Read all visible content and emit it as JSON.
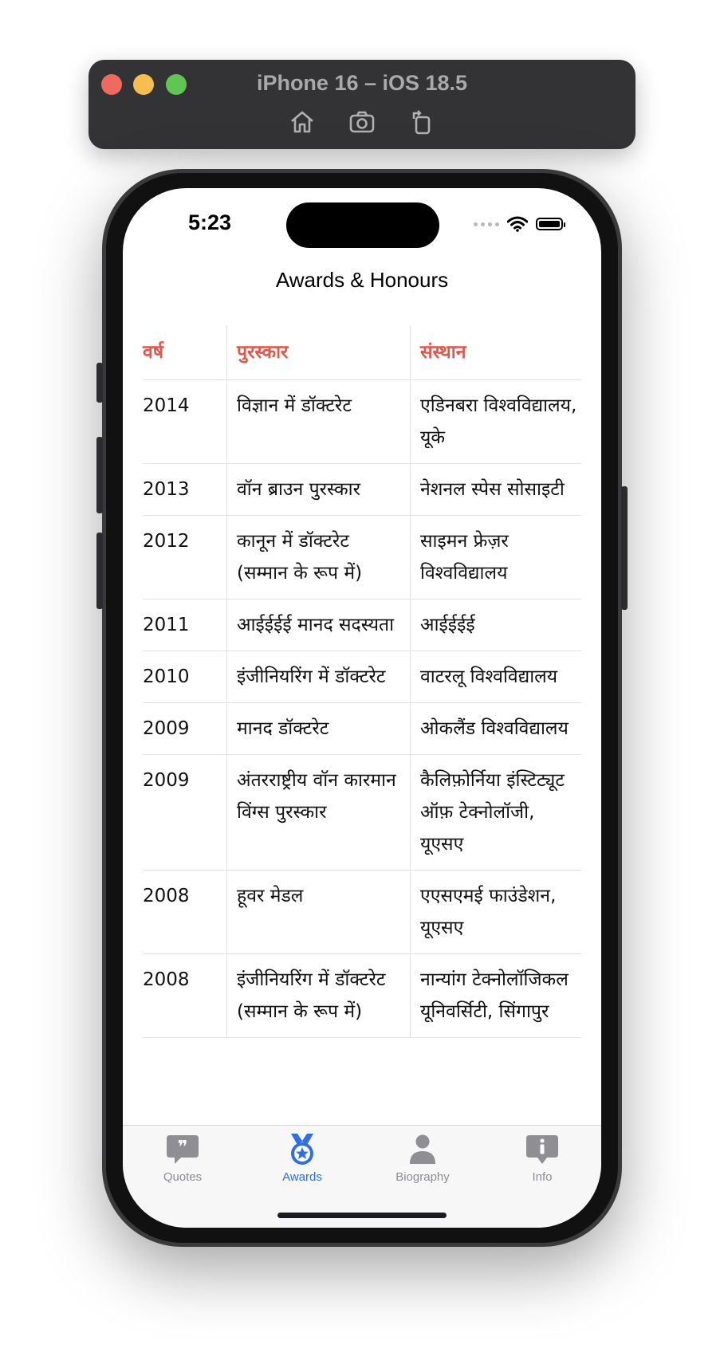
{
  "simulator": {
    "title": "iPhone 16 – iOS 18.5",
    "tools": [
      "home-icon",
      "screenshot-icon",
      "rotate-icon"
    ]
  },
  "status_bar": {
    "time": "5:23"
  },
  "nav": {
    "title": "Awards & Honours"
  },
  "table": {
    "headers": [
      "वर्ष",
      "पुरस्कार",
      "संस्थान"
    ],
    "header_color": "#e2574c",
    "rows": [
      {
        "year": "2014",
        "award": "विज्ञान में डॉक्टरेट",
        "institution": "एडिनबरा विश्वविद्यालय, यूके"
      },
      {
        "year": "2013",
        "award": "वॉन ब्राउन पुरस्कार",
        "institution": "नेशनल स्पेस सोसाइटी"
      },
      {
        "year": "2012",
        "award": "कानून में डॉक्टरेट (सम्मान के रूप में)",
        "institution": "साइमन फ्रेज़र विश्वविद्यालय"
      },
      {
        "year": "2011",
        "award": "आईईईई मानद सदस्यता",
        "institution": "आईईईई"
      },
      {
        "year": "2010",
        "award": "इंजीनियरिंग में डॉक्टरेट",
        "institution": "वाटरलू विश्वविद्यालय"
      },
      {
        "year": "2009",
        "award": "मानद डॉक्टरेट",
        "institution": "ओकलैंड विश्वविद्यालय"
      },
      {
        "year": "2009",
        "award": "अंतरराष्ट्रीय वॉन कारमान विंग्स पुरस्कार",
        "institution": "कैलिफ़ोर्निया इंस्टिट्यूट ऑफ़ टेक्नोलॉजी, यूएसए"
      },
      {
        "year": "2008",
        "award": "हूवर मेडल",
        "institution": "एएसएमई फाउंडेशन, यूएसए"
      },
      {
        "year": "2008",
        "award": "इंजीनियरिंग में डॉक्टरेट (सम्मान के रूप में)",
        "institution": "नान्यांग टेक्नोलॉजिकल यूनिवर्सिटी, सिंगापुर"
      }
    ]
  },
  "tabbar": {
    "active_color": "#2f6fe0",
    "tabs": [
      {
        "label": "Quotes",
        "icon": "quote-bubble-icon"
      },
      {
        "label": "Awards",
        "icon": "medal-icon"
      },
      {
        "label": "Biography",
        "icon": "person-icon"
      },
      {
        "label": "Info",
        "icon": "info-bubble-icon"
      }
    ]
  }
}
